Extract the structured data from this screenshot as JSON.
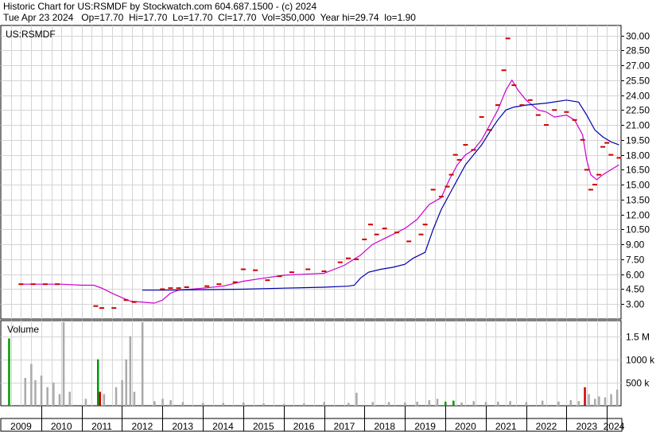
{
  "header": {
    "line1": "Historic Chart for US:RSMDF by Stockwatch.com 604.687.1500 - (c) 2024",
    "line2": "Tue Apr 23 2024   Op=17.70  Hi=17.70  Lo=17.70  Cl=17.70  Vol=350,000  Year hi=29.74  lo=1.90"
  },
  "colors": {
    "price": "#cc0000",
    "ma_short": "#cc00cc",
    "ma_long": "#0000aa",
    "volume": "#aaaaaa",
    "volume_up": "#009900",
    "volume_down": "#cc0000",
    "grid": "#d4d4d4"
  },
  "chart_data": [
    {
      "type": "line",
      "title": "US:RSMDF",
      "y_ticks": [
        "3.00",
        "4.50",
        "6.00",
        "7.50",
        "9.00",
        "10.50",
        "12.00",
        "13.50",
        "15.00",
        "16.50",
        "18.00",
        "19.50",
        "21.00",
        "22.50",
        "24.00",
        "25.50",
        "27.00",
        "28.50",
        "30.00"
      ],
      "ylim": [
        1.5,
        31.0
      ],
      "grid": true,
      "series": [
        {
          "key": "price",
          "points": [
            [
              2009.5,
              5.0
            ],
            [
              2009.8,
              5.0
            ],
            [
              2010.1,
              5.0
            ],
            [
              2010.4,
              5.0
            ],
            [
              2011.35,
              2.8
            ],
            [
              2011.5,
              2.6
            ],
            [
              2011.8,
              2.6
            ],
            [
              2012.1,
              3.4
            ],
            [
              2012.3,
              3.2
            ],
            [
              2013.0,
              4.5
            ],
            [
              2013.2,
              4.6
            ],
            [
              2013.4,
              4.6
            ],
            [
              2013.6,
              4.7
            ],
            [
              2014.1,
              4.8
            ],
            [
              2014.4,
              5.0
            ],
            [
              2014.8,
              5.2
            ],
            [
              2015.0,
              6.5
            ],
            [
              2015.3,
              6.4
            ],
            [
              2015.6,
              5.4
            ],
            [
              2015.9,
              5.8
            ],
            [
              2016.2,
              6.2
            ],
            [
              2016.6,
              6.5
            ],
            [
              2017.0,
              6.3
            ],
            [
              2017.4,
              7.2
            ],
            [
              2017.6,
              7.6
            ],
            [
              2017.8,
              7.5
            ],
            [
              2018.0,
              9.5
            ],
            [
              2018.15,
              11.0
            ],
            [
              2018.3,
              10.0
            ],
            [
              2018.5,
              10.6
            ],
            [
              2018.8,
              10.2
            ],
            [
              2019.1,
              9.3
            ],
            [
              2019.4,
              10.0
            ],
            [
              2019.5,
              11.0
            ],
            [
              2019.7,
              14.5
            ],
            [
              2019.9,
              13.8
            ],
            [
              2020.05,
              14.8
            ],
            [
              2020.15,
              16.0
            ],
            [
              2020.25,
              18.0
            ],
            [
              2020.35,
              17.5
            ],
            [
              2020.5,
              19.0
            ],
            [
              2020.7,
              18.5
            ],
            [
              2020.9,
              21.8
            ],
            [
              2021.1,
              20.5
            ],
            [
              2021.3,
              23.0
            ],
            [
              2021.45,
              26.5
            ],
            [
              2021.55,
              29.7
            ],
            [
              2021.7,
              25.0
            ],
            [
              2021.9,
              23.0
            ],
            [
              2022.1,
              23.5
            ],
            [
              2022.3,
              22.0
            ],
            [
              2022.5,
              21.0
            ],
            [
              2022.7,
              22.5
            ],
            [
              2023.0,
              22.3
            ],
            [
              2023.2,
              21.5
            ],
            [
              2023.4,
              19.5
            ],
            [
              2023.5,
              16.5
            ],
            [
              2023.6,
              14.5
            ],
            [
              2023.7,
              15.0
            ],
            [
              2023.8,
              16.0
            ],
            [
              2023.9,
              18.8
            ],
            [
              2024.0,
              19.2
            ],
            [
              2024.1,
              18.0
            ],
            [
              2024.3,
              17.7
            ]
          ]
        },
        {
          "key": "ma_short",
          "points": [
            [
              2009.5,
              5.0
            ],
            [
              2010.5,
              5.0
            ],
            [
              2011.0,
              4.9
            ],
            [
              2011.3,
              4.9
            ],
            [
              2011.5,
              4.6
            ],
            [
              2011.8,
              4.0
            ],
            [
              2012.2,
              3.3
            ],
            [
              2012.8,
              3.1
            ],
            [
              2013.0,
              3.4
            ],
            [
              2013.2,
              4.1
            ],
            [
              2013.4,
              4.4
            ],
            [
              2014.0,
              4.6
            ],
            [
              2014.5,
              4.8
            ],
            [
              2015.0,
              5.3
            ],
            [
              2015.5,
              5.6
            ],
            [
              2016.0,
              5.9
            ],
            [
              2016.5,
              6.0
            ],
            [
              2017.0,
              6.1
            ],
            [
              2017.5,
              6.9
            ],
            [
              2017.9,
              7.9
            ],
            [
              2018.2,
              9.0
            ],
            [
              2018.5,
              9.6
            ],
            [
              2018.8,
              10.2
            ],
            [
              2019.0,
              10.6
            ],
            [
              2019.3,
              11.5
            ],
            [
              2019.6,
              13.0
            ],
            [
              2019.9,
              13.7
            ],
            [
              2020.1,
              15.5
            ],
            [
              2020.3,
              17.0
            ],
            [
              2020.5,
              18.0
            ],
            [
              2020.7,
              18.5
            ],
            [
              2020.9,
              19.5
            ],
            [
              2021.1,
              21.0
            ],
            [
              2021.3,
              22.5
            ],
            [
              2021.5,
              24.5
            ],
            [
              2021.65,
              25.5
            ],
            [
              2021.8,
              24.5
            ],
            [
              2022.0,
              23.5
            ],
            [
              2022.3,
              22.5
            ],
            [
              2022.5,
              22.3
            ],
            [
              2022.7,
              21.8
            ],
            [
              2023.0,
              22.0
            ],
            [
              2023.2,
              21.5
            ],
            [
              2023.4,
              20.0
            ],
            [
              2023.5,
              17.5
            ],
            [
              2023.6,
              16.0
            ],
            [
              2023.75,
              15.5
            ],
            [
              2023.9,
              16.0
            ],
            [
              2024.1,
              16.5
            ],
            [
              2024.3,
              17.0
            ]
          ]
        },
        {
          "key": "ma_long",
          "points": [
            [
              2012.5,
              4.4
            ],
            [
              2013.0,
              4.4
            ],
            [
              2014.0,
              4.45
            ],
            [
              2015.0,
              4.5
            ],
            [
              2016.0,
              4.6
            ],
            [
              2017.0,
              4.7
            ],
            [
              2017.6,
              4.8
            ],
            [
              2017.75,
              4.9
            ],
            [
              2017.9,
              5.6
            ],
            [
              2018.1,
              6.2
            ],
            [
              2018.4,
              6.5
            ],
            [
              2018.7,
              6.7
            ],
            [
              2019.0,
              7.0
            ],
            [
              2019.2,
              7.6
            ],
            [
              2019.5,
              8.2
            ],
            [
              2019.7,
              10.5
            ],
            [
              2019.9,
              12.5
            ],
            [
              2020.1,
              14.0
            ],
            [
              2020.3,
              15.5
            ],
            [
              2020.5,
              17.0
            ],
            [
              2020.7,
              18.0
            ],
            [
              2020.9,
              19.0
            ],
            [
              2021.1,
              20.3
            ],
            [
              2021.3,
              21.5
            ],
            [
              2021.5,
              22.5
            ],
            [
              2021.7,
              22.8
            ],
            [
              2022.0,
              23.0
            ],
            [
              2022.5,
              23.2
            ],
            [
              2023.0,
              23.5
            ],
            [
              2023.3,
              23.3
            ],
            [
              2023.5,
              22.0
            ],
            [
              2023.7,
              20.5
            ],
            [
              2023.9,
              19.8
            ],
            [
              2024.1,
              19.3
            ],
            [
              2024.3,
              19.0
            ]
          ]
        }
      ]
    },
    {
      "type": "bar",
      "title": "Volume",
      "y_ticks": [
        "500 k",
        "1000 k",
        "1.5 M"
      ],
      "ylim": [
        0,
        1800000
      ],
      "bars": [
        [
          2009.2,
          1450000,
          "up"
        ],
        [
          2009.6,
          600000,
          "flat"
        ],
        [
          2009.75,
          900000,
          "flat"
        ],
        [
          2009.85,
          550000,
          "flat"
        ],
        [
          2010.0,
          650000,
          "flat"
        ],
        [
          2010.15,
          400000,
          "flat"
        ],
        [
          2010.3,
          500000,
          "flat"
        ],
        [
          2010.45,
          250000,
          "flat"
        ],
        [
          2010.55,
          1800000,
          "flat"
        ],
        [
          2010.7,
          300000,
          "flat"
        ],
        [
          2011.1,
          150000,
          "flat"
        ],
        [
          2011.4,
          1000000,
          "up"
        ],
        [
          2011.45,
          300000,
          "down"
        ],
        [
          2011.55,
          250000,
          "flat"
        ],
        [
          2011.85,
          400000,
          "flat"
        ],
        [
          2012.0,
          550000,
          "flat"
        ],
        [
          2012.1,
          1000000,
          "flat"
        ],
        [
          2012.2,
          1500000,
          "flat"
        ],
        [
          2012.3,
          300000,
          "flat"
        ],
        [
          2012.5,
          1800000,
          "flat"
        ],
        [
          2012.8,
          100000,
          "flat"
        ],
        [
          2013.0,
          150000,
          "flat"
        ],
        [
          2013.2,
          120000,
          "flat"
        ],
        [
          2013.5,
          80000,
          "flat"
        ],
        [
          2014.0,
          60000,
          "flat"
        ],
        [
          2014.5,
          60000,
          "flat"
        ],
        [
          2015.0,
          70000,
          "flat"
        ],
        [
          2015.5,
          50000,
          "flat"
        ],
        [
          2016.0,
          40000,
          "flat"
        ],
        [
          2016.5,
          50000,
          "flat"
        ],
        [
          2017.0,
          80000,
          "flat"
        ],
        [
          2017.6,
          60000,
          "flat"
        ],
        [
          2017.8,
          280000,
          "flat"
        ],
        [
          2018.2,
          80000,
          "flat"
        ],
        [
          2018.6,
          80000,
          "flat"
        ],
        [
          2019.0,
          70000,
          "flat"
        ],
        [
          2019.3,
          90000,
          "flat"
        ],
        [
          2019.6,
          120000,
          "flat"
        ],
        [
          2019.8,
          150000,
          "flat"
        ],
        [
          2020.0,
          90000,
          "up"
        ],
        [
          2020.2,
          110000,
          "up"
        ],
        [
          2020.4,
          70000,
          "flat"
        ],
        [
          2020.7,
          100000,
          "flat"
        ],
        [
          2021.0,
          80000,
          "flat"
        ],
        [
          2021.3,
          90000,
          "flat"
        ],
        [
          2021.6,
          100000,
          "flat"
        ],
        [
          2022.0,
          80000,
          "flat"
        ],
        [
          2022.4,
          110000,
          "flat"
        ],
        [
          2022.8,
          90000,
          "flat"
        ],
        [
          2023.1,
          120000,
          "flat"
        ],
        [
          2023.3,
          100000,
          "flat"
        ],
        [
          2023.45,
          400000,
          "down"
        ],
        [
          2023.55,
          250000,
          "flat"
        ],
        [
          2023.7,
          150000,
          "flat"
        ],
        [
          2023.8,
          200000,
          "flat"
        ],
        [
          2023.95,
          180000,
          "flat"
        ],
        [
          2024.1,
          250000,
          "flat"
        ],
        [
          2024.25,
          350000,
          "flat"
        ]
      ]
    }
  ],
  "price_panel_label": "US:RSMDF",
  "volume_panel_label": "Volume",
  "x_axis": {
    "labels": [
      "2009",
      "2010",
      "2011",
      "2012",
      "2013",
      "2014",
      "2015",
      "2016",
      "2017",
      "2018",
      "2019",
      "2020",
      "2021",
      "2022",
      "2023",
      "2024"
    ]
  }
}
